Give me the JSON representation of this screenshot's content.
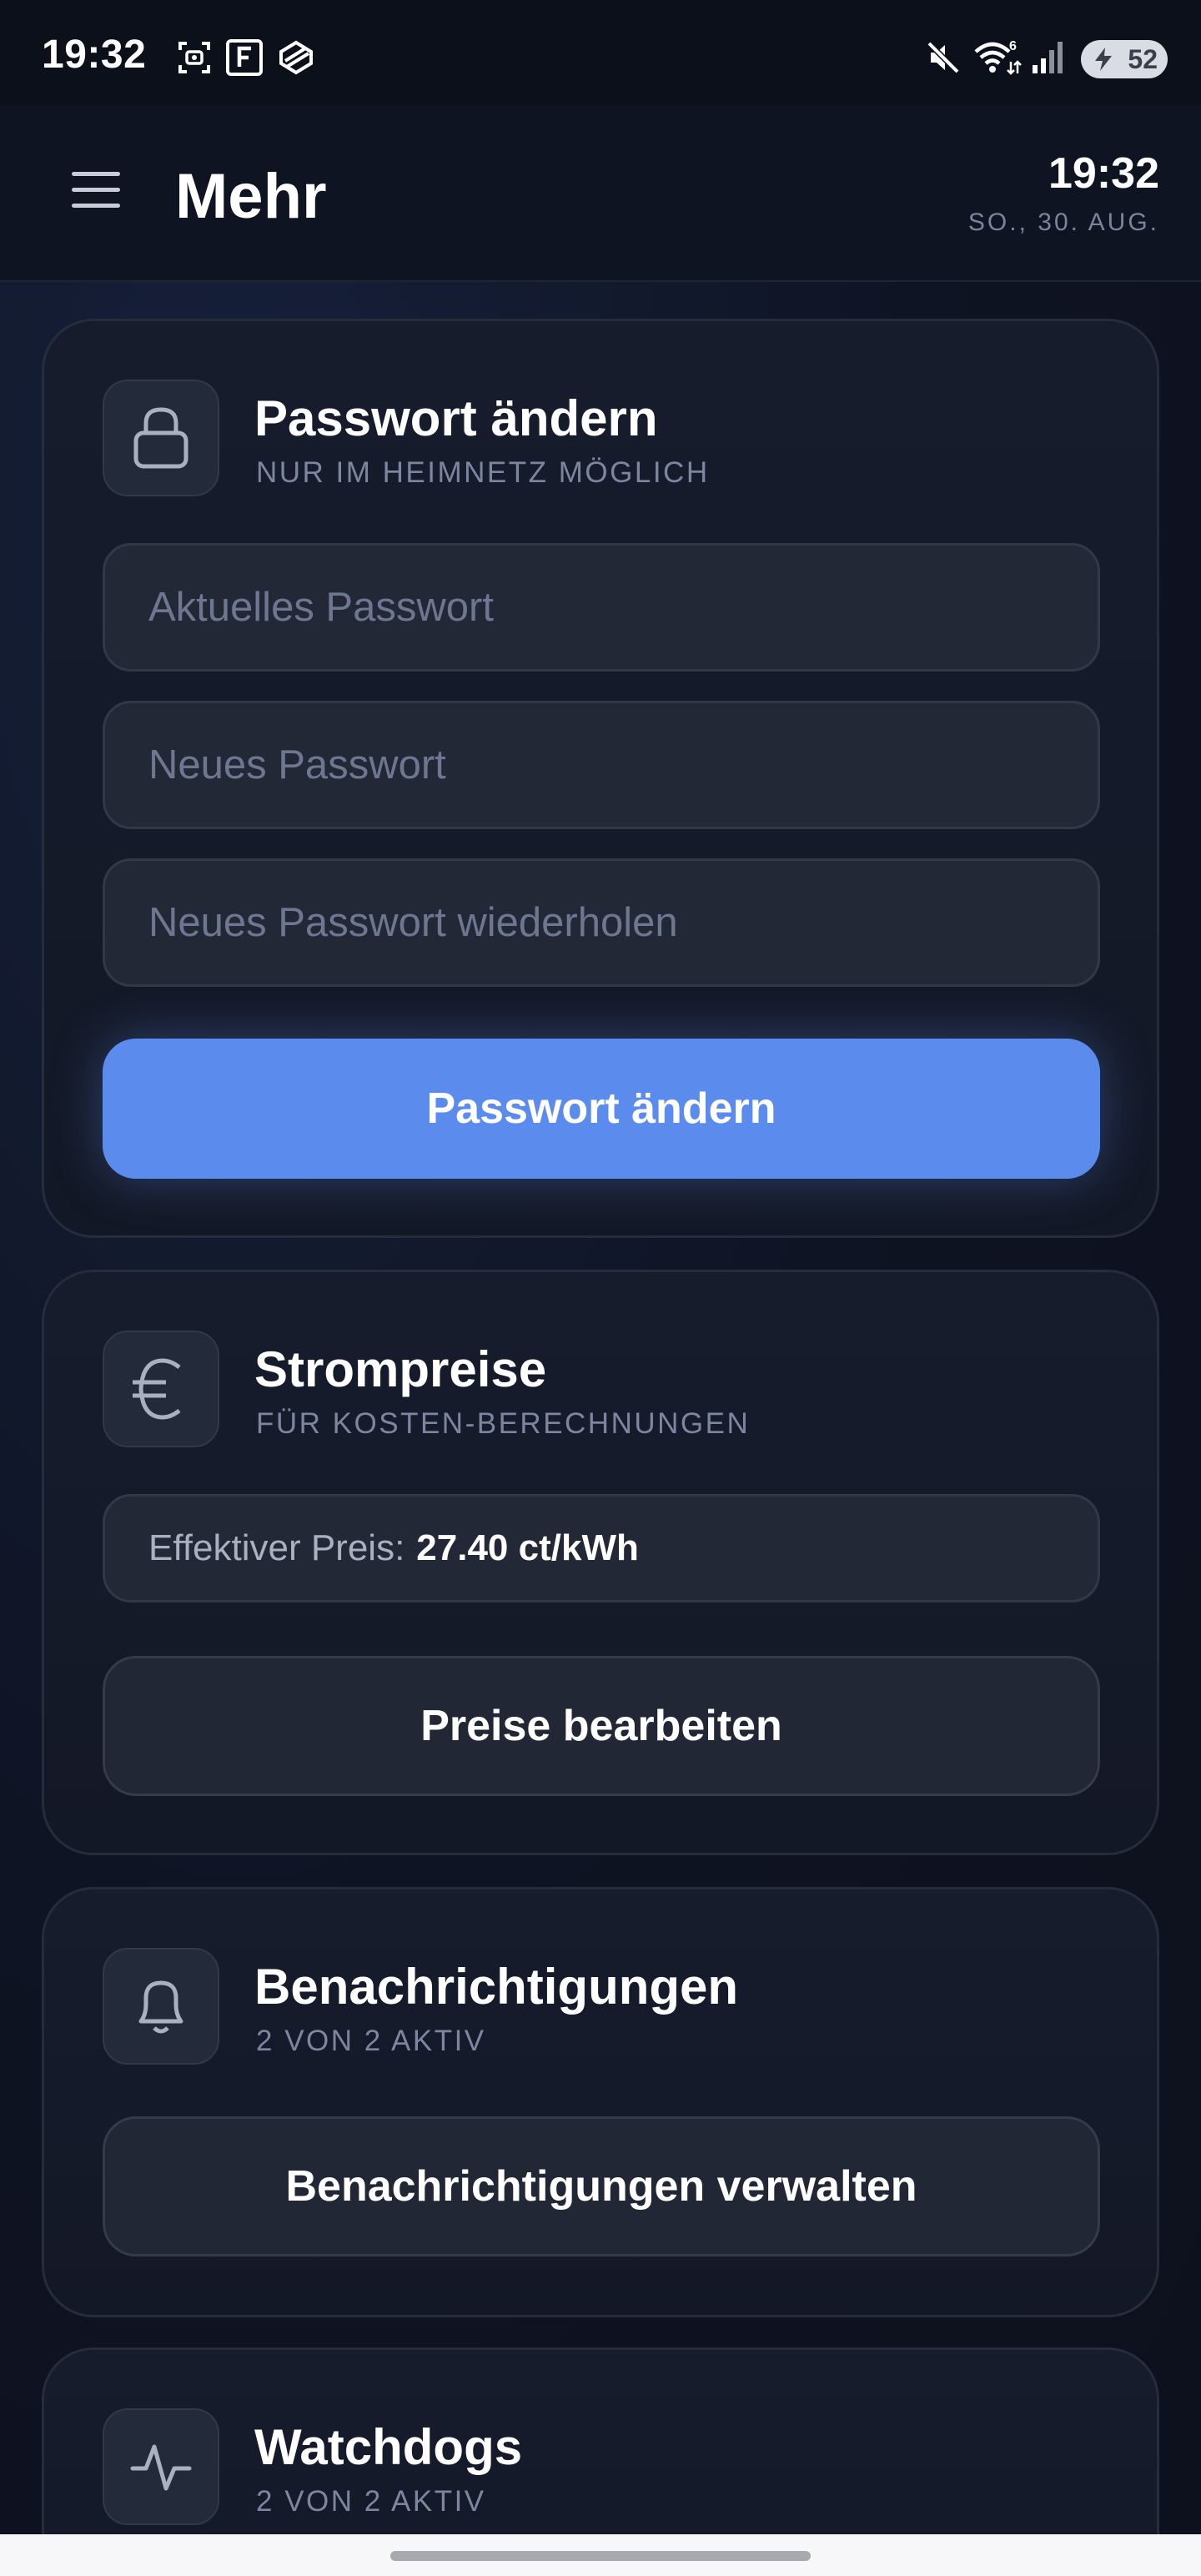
{
  "status_bar": {
    "time": "19:32",
    "icons": [
      "screenshot-icon",
      "f-app-icon",
      "box-app-icon",
      "mute-icon",
      "wifi-icon",
      "signal-icon"
    ],
    "wifi_badge": "6",
    "battery": "52"
  },
  "header": {
    "title": "Mehr",
    "time": "19:32",
    "date": "SO., 30. AUG."
  },
  "password_card": {
    "title": "Passwort ändern",
    "subtitle": "NUR IM HEIMNETZ MÖGLICH",
    "current_placeholder": "Aktuelles Passwort",
    "new_placeholder": "Neues Passwort",
    "repeat_placeholder": "Neues Passwort wiederholen",
    "button": "Passwort ändern",
    "icon": "lock-icon"
  },
  "price_card": {
    "title": "Strompreise",
    "subtitle": "FÜR KOSTEN-BERECHNUNGEN",
    "effective_label": "Effektiver Preis:",
    "effective_value": "27.40 ct/kWh",
    "button": "Preise bearbeiten",
    "icon": "euro-icon"
  },
  "notifications_card": {
    "title": "Benachrichtigungen",
    "subtitle": "2 VON 2 AKTIV",
    "button": "Benachrichtigungen verwalten",
    "icon": "bell-icon"
  },
  "watchdogs_card": {
    "title": "Watchdogs",
    "subtitle": "2 VON 2 AKTIV",
    "icon": "activity-icon"
  },
  "colors": {
    "background": "#0e1322",
    "card": "#161c2c",
    "accent": "#5b8ced",
    "muted_text": "#7c86a0"
  }
}
